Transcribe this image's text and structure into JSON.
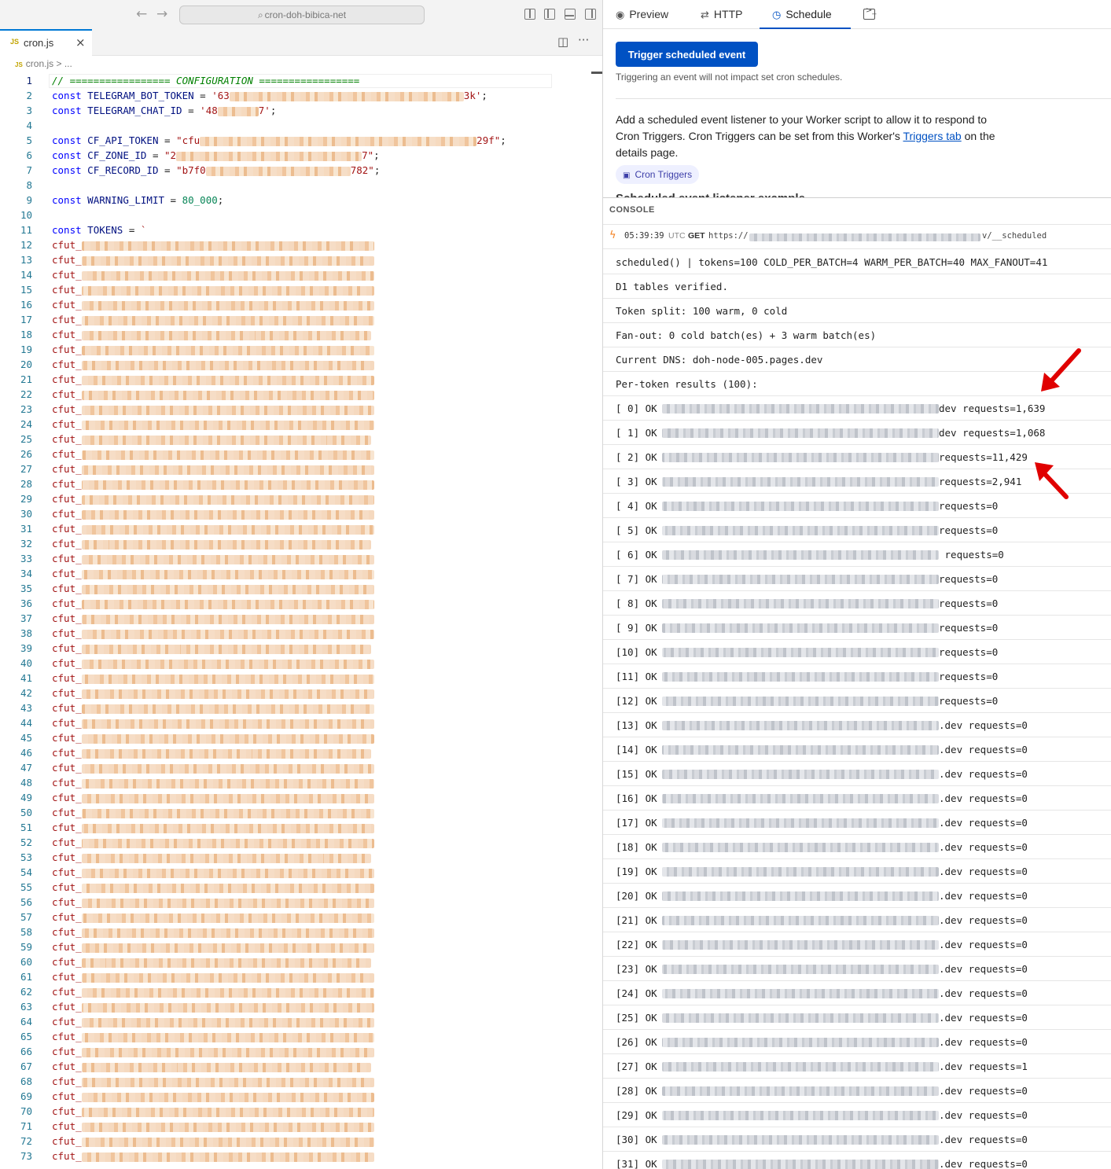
{
  "editor": {
    "nav": {
      "back_icon": "←",
      "forward_icon": "→"
    },
    "search": {
      "icon": "⌕",
      "text": "cron-doh-bibica-net"
    },
    "tab": {
      "badge": "JS",
      "name": "cron.js",
      "close": "×"
    },
    "breadcrumb": {
      "badge": "JS",
      "text": "cron.js > ..."
    },
    "actions": {
      "split_icon": "◫",
      "more_icon": "···"
    },
    "config_comment": "// ================= CONFIGURATION =================",
    "lines": [
      {
        "n": "1"
      },
      {
        "n": "2"
      },
      {
        "n": "3"
      },
      {
        "n": "4"
      },
      {
        "n": "5"
      },
      {
        "n": "6"
      },
      {
        "n": "7"
      },
      {
        "n": "8"
      },
      {
        "n": "9"
      },
      {
        "n": "10"
      },
      {
        "n": "11"
      },
      {
        "n": "12"
      },
      {
        "n": "13"
      },
      {
        "n": "14"
      },
      {
        "n": "15"
      },
      {
        "n": "16"
      },
      {
        "n": "17"
      },
      {
        "n": "18"
      },
      {
        "n": "19"
      },
      {
        "n": "20"
      },
      {
        "n": "21"
      },
      {
        "n": "22"
      },
      {
        "n": "23"
      },
      {
        "n": "24"
      },
      {
        "n": "25"
      },
      {
        "n": "26"
      },
      {
        "n": "27"
      },
      {
        "n": "28"
      },
      {
        "n": "29"
      },
      {
        "n": "30"
      },
      {
        "n": "31"
      },
      {
        "n": "32"
      },
      {
        "n": "33"
      },
      {
        "n": "34"
      },
      {
        "n": "35"
      },
      {
        "n": "36"
      },
      {
        "n": "37"
      },
      {
        "n": "38"
      },
      {
        "n": "39"
      },
      {
        "n": "40"
      },
      {
        "n": "41"
      },
      {
        "n": "42"
      },
      {
        "n": "43"
      },
      {
        "n": "44"
      },
      {
        "n": "45"
      },
      {
        "n": "46"
      },
      {
        "n": "47"
      },
      {
        "n": "48"
      },
      {
        "n": "49"
      },
      {
        "n": "50"
      },
      {
        "n": "51"
      },
      {
        "n": "52"
      },
      {
        "n": "53"
      },
      {
        "n": "54"
      },
      {
        "n": "55"
      },
      {
        "n": "56"
      },
      {
        "n": "57"
      },
      {
        "n": "58"
      },
      {
        "n": "59"
      },
      {
        "n": "60"
      },
      {
        "n": "61"
      },
      {
        "n": "62"
      },
      {
        "n": "63"
      },
      {
        "n": "64"
      },
      {
        "n": "65"
      },
      {
        "n": "66"
      },
      {
        "n": "67"
      },
      {
        "n": "68"
      },
      {
        "n": "69"
      },
      {
        "n": "70"
      },
      {
        "n": "71"
      },
      {
        "n": "72"
      },
      {
        "n": "73"
      }
    ],
    "code": {
      "kw_const": "const",
      "bot_token_name": "TELEGRAM_BOT_TOKEN",
      "bot_token_prefix": "'63",
      "bot_token_suffix": "3k'",
      "chat_id_name": "TELEGRAM_CHAT_ID",
      "chat_id_prefix": "'48",
      "chat_id_suffix": "7'",
      "api_token_name": "CF_API_TOKEN",
      "api_token_prefix": "\"cfu",
      "api_token_suffix": "29f\"",
      "zone_id_name": "CF_ZONE_ID",
      "zone_id_prefix": "\"2",
      "zone_id_suffix": "7\"",
      "record_id_name": "CF_RECORD_ID",
      "record_id_prefix": "\"b7f0",
      "record_id_suffix": "782\"",
      "warning_name": "WARNING_LIMIT",
      "warning_value": "80_000",
      "tokens_name": "TOKENS",
      "tokens_open": "`",
      "token_prefix": "cfut_",
      "eq": " = ",
      "semi": ";"
    }
  },
  "panel": {
    "tabs": [
      {
        "icon": "◉",
        "label": "Preview"
      },
      {
        "icon": "⇄",
        "label": "HTTP"
      },
      {
        "icon": "◷",
        "label": "Schedule"
      }
    ],
    "terminal_icon": ">_",
    "trigger_button": "Trigger scheduled event",
    "trigger_note": "Triggering an event will not impact set cron schedules.",
    "desc_before_link": "Add a scheduled event listener to your Worker script to allow it to respond to Cron Triggers. Cron Triggers can be set from this Worker's ",
    "desc_link": "Triggers tab",
    "desc_after_link": " on the details page.",
    "chip_icon": "▣",
    "chip_label": "Cron Triggers",
    "peek_heading": "Scheduled event listener example"
  },
  "console": {
    "label": "CONSOLE",
    "request": {
      "icon": "ϟ",
      "time": "05:39:39",
      "tz": "UTC",
      "method": "GET",
      "url_start": "https://",
      "url_end": "v/__scheduled"
    },
    "messages": [
      "scheduled() | tokens=100 COLD_PER_BATCH=4 WARM_PER_BATCH=40 MAX_FANOUT=41",
      "D1 tables verified.",
      "Token split: 100 warm, 0 cold",
      "Fan-out: 0 cold batch(es) + 3 warm batch(es)",
      "Current DNS: doh-node-005.pages.dev",
      "Per-token results (100):"
    ],
    "results": [
      {
        "idx": "[ 0] OK",
        "tail": "dev requests=1,639"
      },
      {
        "idx": "[ 1] OK",
        "tail": "dev requests=1,068"
      },
      {
        "idx": "[ 2] OK",
        "tail": "requests=11,429"
      },
      {
        "idx": "[ 3] OK",
        "tail": "requests=2,941"
      },
      {
        "idx": "[ 4] OK",
        "tail": "requests=0"
      },
      {
        "idx": "[ 5] OK",
        "tail": "requests=0"
      },
      {
        "idx": "[ 6] OK",
        "tail": " requests=0"
      },
      {
        "idx": "[ 7] OK",
        "tail": "requests=0"
      },
      {
        "idx": "[ 8] OK",
        "tail": "requests=0"
      },
      {
        "idx": "[ 9] OK",
        "tail": "requests=0"
      },
      {
        "idx": "[10] OK",
        "tail": "requests=0"
      },
      {
        "idx": "[11] OK",
        "tail": "requests=0"
      },
      {
        "idx": "[12] OK",
        "tail": "requests=0"
      },
      {
        "idx": "[13] OK",
        "tail": ".dev requests=0"
      },
      {
        "idx": "[14] OK",
        "tail": ".dev requests=0"
      },
      {
        "idx": "[15] OK",
        "tail": ".dev requests=0"
      },
      {
        "idx": "[16] OK",
        "tail": ".dev requests=0"
      },
      {
        "idx": "[17] OK",
        "tail": ".dev requests=0"
      },
      {
        "idx": "[18] OK",
        "tail": ".dev requests=0"
      },
      {
        "idx": "[19] OK",
        "tail": ".dev requests=0"
      },
      {
        "idx": "[20] OK",
        "tail": ".dev requests=0"
      },
      {
        "idx": "[21] OK",
        "tail": ".dev requests=0"
      },
      {
        "idx": "[22] OK",
        "tail": ".dev requests=0"
      },
      {
        "idx": "[23] OK",
        "tail": ".dev requests=0"
      },
      {
        "idx": "[24] OK",
        "tail": ".dev requests=0"
      },
      {
        "idx": "[25] OK",
        "tail": ".dev requests=0"
      },
      {
        "idx": "[26] OK",
        "tail": ".dev requests=0"
      },
      {
        "idx": "[27] OK",
        "tail": ".dev requests=1"
      },
      {
        "idx": "[28] OK",
        "tail": ".dev requests=0"
      },
      {
        "idx": "[29] OK",
        "tail": ".dev requests=0"
      },
      {
        "idx": "[30] OK",
        "tail": ".dev requests=0"
      },
      {
        "idx": "[31] OK",
        "tail": ".dev requests=0"
      }
    ]
  },
  "colors": {
    "accent": "#0051c3",
    "annotation_arrow": "#e00000",
    "vscode_blue": "#0078d4"
  }
}
